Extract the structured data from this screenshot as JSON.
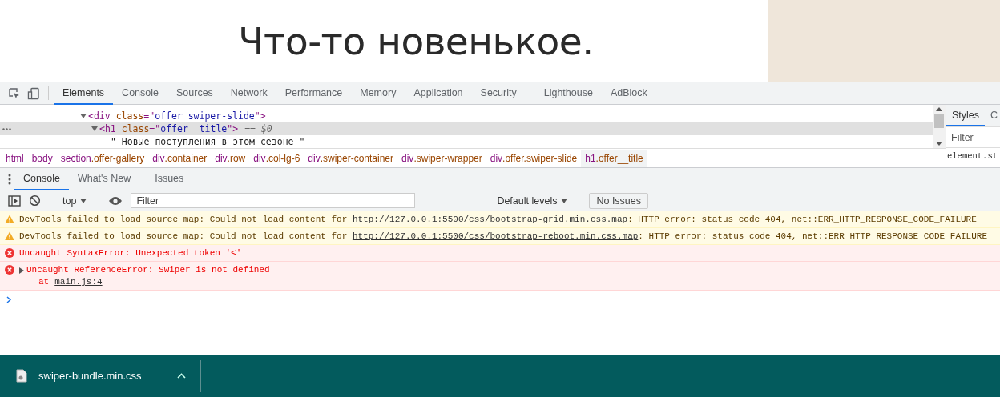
{
  "page": {
    "heading": "Что-то новенькое."
  },
  "devtools_tabs": [
    {
      "label": "Elements",
      "selected": true
    },
    {
      "label": "Console",
      "selected": false
    },
    {
      "label": "Sources",
      "selected": false
    },
    {
      "label": "Network",
      "selected": false
    },
    {
      "label": "Performance",
      "selected": false
    },
    {
      "label": "Memory",
      "selected": false
    },
    {
      "label": "Application",
      "selected": false
    },
    {
      "label": "Security",
      "selected": false
    },
    {
      "label": "Lighthouse",
      "selected": false
    },
    {
      "label": "AdBlock",
      "selected": false
    }
  ],
  "dom_tree": [
    {
      "kind": "element",
      "expanded": true,
      "selected": false,
      "parts": [
        {
          "kind": "punct",
          "text": "<"
        },
        {
          "kind": "tag",
          "text": "div"
        },
        {
          "kind": "attr",
          "text": " class"
        },
        {
          "kind": "punct",
          "text": "=\""
        },
        {
          "kind": "value",
          "text": "offer swiper-slide"
        },
        {
          "kind": "punct",
          "text": "\">"
        }
      ],
      "children": [
        {
          "kind": "element",
          "expanded": true,
          "selected": true,
          "suffix": "== $0",
          "parts": [
            {
              "kind": "punct",
              "text": "<"
            },
            {
              "kind": "tag",
              "text": "h1"
            },
            {
              "kind": "attr",
              "text": " class"
            },
            {
              "kind": "punct",
              "text": "=\""
            },
            {
              "kind": "value",
              "text": "offer__title"
            },
            {
              "kind": "punct",
              "text": "\">"
            }
          ],
          "children": [
            {
              "kind": "text",
              "text": "\" Новые поступления в этом сезоне \""
            }
          ]
        }
      ]
    }
  ],
  "breadcrumbs": [
    {
      "tag": "html",
      "selected": false
    },
    {
      "tag": "body",
      "selected": false
    },
    {
      "tag": "section",
      "cls": ".offer-gallery",
      "selected": false
    },
    {
      "tag": "div",
      "cls": ".container",
      "selected": false
    },
    {
      "tag": "div",
      "cls": ".row",
      "selected": false
    },
    {
      "tag": "div",
      "cls": ".col-lg-6",
      "selected": false
    },
    {
      "tag": "div",
      "cls": ".swiper-container",
      "selected": false
    },
    {
      "tag": "div",
      "cls": ".swiper-wrapper",
      "selected": false
    },
    {
      "tag": "div",
      "cls": ".offer.swiper-slide",
      "selected": false
    },
    {
      "tag": "h1",
      "cls": ".offer__title",
      "selected": true
    }
  ],
  "styles_pane": {
    "tabs": [
      {
        "label": "Styles",
        "selected": true
      },
      {
        "label": "C",
        "selected": false
      }
    ],
    "filter": {
      "placeholder": "Filter"
    },
    "rule": "element.st"
  },
  "drawer_tabs": [
    {
      "label": "Console",
      "selected": true
    },
    {
      "label": "What's New",
      "selected": false
    },
    {
      "label": "Issues",
      "selected": false
    }
  ],
  "console_toolbar": {
    "context": "top",
    "filter": {
      "placeholder": "Filter"
    },
    "levels": "Default levels",
    "issues_button": "No Issues"
  },
  "messages": [
    {
      "kind": "warning",
      "text": "DevTools failed to load source map: Could not load content for",
      "link": "http://127.0.0.1:5500/css/bootstrap-grid.min.css.map",
      "after": ": HTTP error: status code 404, net::ERR_HTTP_RESPONSE_CODE_FAILURE"
    },
    {
      "kind": "warning",
      "text": "DevTools failed to load source map: Could not load content for",
      "link": "http://127.0.0.1:5500/css/bootstrap-reboot.min.css.map",
      "after": ": HTTP error: status code 404, net::ERR_HTTP_RESPONSE_CODE_FAILURE"
    },
    {
      "kind": "error",
      "text": "Uncaught SyntaxError: Unexpected token '<'"
    },
    {
      "kind": "error",
      "text": "Uncaught ReferenceError: Swiper is not defined",
      "expandable": true,
      "stack": {
        "prefix": "at",
        "link": "main.js:4"
      }
    }
  ],
  "download_bar": {
    "file": "swiper-bundle.min.css"
  }
}
